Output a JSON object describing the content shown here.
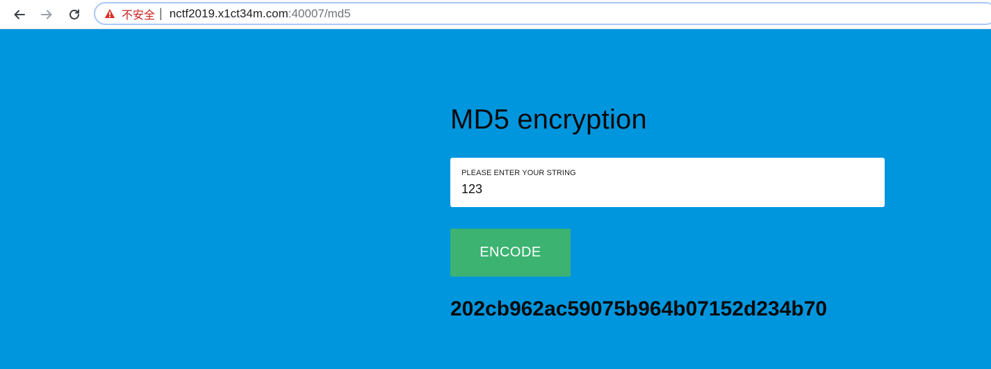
{
  "browser": {
    "security_label": "不安全",
    "separator": "|",
    "url_host": "nctf2019.x1ct34m.com",
    "url_rest": ":40007/md5",
    "icons": {
      "back": "arrow-left-icon",
      "forward": "arrow-right-icon",
      "reload": "reload-icon",
      "warning": "warning-triangle-icon"
    },
    "warning_color": "#d93025"
  },
  "page": {
    "background": "#0096de",
    "title": "MD5 encryption",
    "input": {
      "label": "PLEASE ENTER YOUR STRING",
      "value": "123"
    },
    "encode_button": "ENCODE",
    "button_color": "#3cb371",
    "result": "202cb962ac59075b964b07152d234b70"
  }
}
